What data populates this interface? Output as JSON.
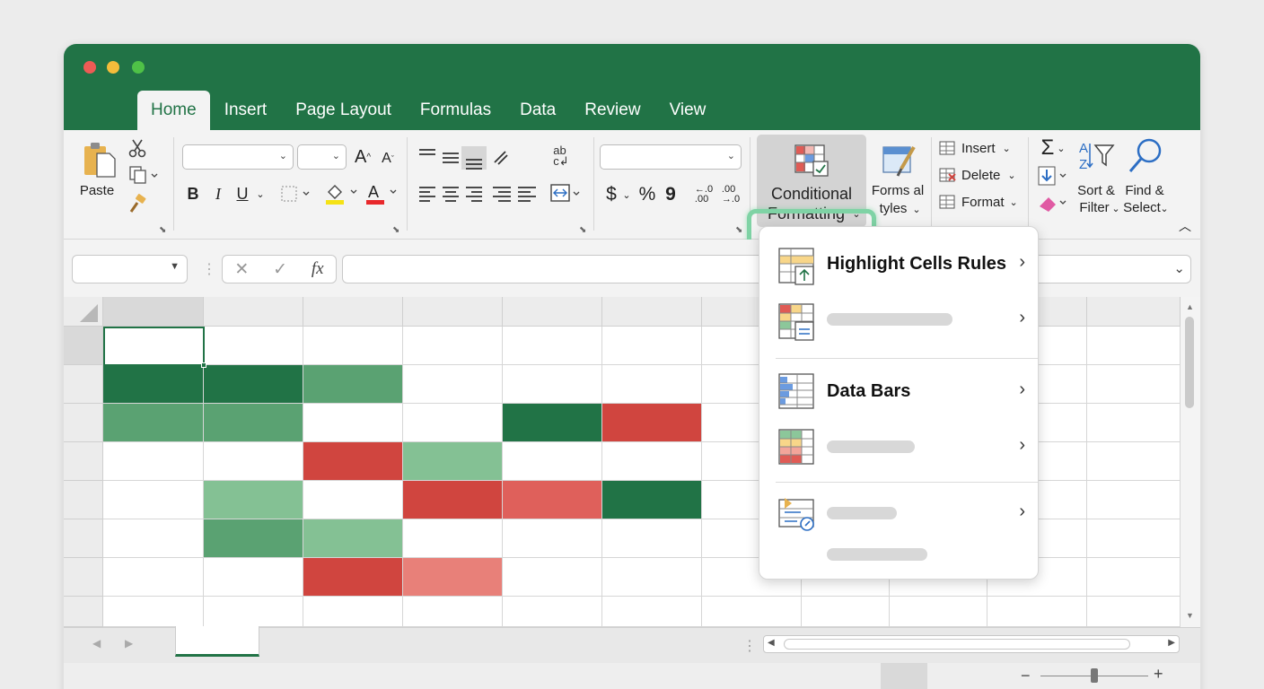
{
  "tabs": [
    "Home",
    "Insert",
    "Page Layout",
    "Formulas",
    "Data",
    "Review",
    "View"
  ],
  "active_tab": "Home",
  "clipboard": {
    "paste_label": "Paste"
  },
  "font_group": {
    "bold": "B",
    "italic": "I",
    "underline": "U"
  },
  "number_group": {
    "currency": "$",
    "percent": "%",
    "comma": "9",
    "inc_decimal": "←.0\n.00",
    "dec_decimal": ".00\n→.0"
  },
  "conditional_formatting": {
    "line1": "Conditional",
    "line2": "Formatting"
  },
  "format_as_table": {
    "line1": "Forms al",
    "line2": "tyles"
  },
  "cells_group": {
    "insert": "Insert",
    "delete": "Delete",
    "format": "Format"
  },
  "editing_group": {
    "sort_line1": "Sort &",
    "sort_line2": "Filter",
    "find_line1": "Find &",
    "find_line2": "Select"
  },
  "formula_bar": {
    "fx": "fx",
    "cancel": "✕",
    "enter": "✓"
  },
  "menu": {
    "items": [
      {
        "label": "Highlight Cells Rules"
      },
      {
        "label": ""
      },
      {
        "label": "Data Bars"
      },
      {
        "label": ""
      },
      {
        "label": ""
      }
    ]
  },
  "colors": {
    "brand_green": "#217346",
    "dark_green": "#217346",
    "mid_green": "#5aa272",
    "light_green": "#84c194",
    "red": "#d0453f",
    "light_red": "#df605b",
    "pink": "#e88079"
  },
  "grid_fills": [
    [
      "",
      "",
      "",
      "",
      "",
      "",
      ""
    ],
    [
      "dark_green",
      "dark_green",
      "mid_green",
      "",
      "",
      "",
      ""
    ],
    [
      "mid_green",
      "mid_green",
      "",
      "",
      "dark_green",
      "red",
      ""
    ],
    [
      "",
      "",
      "red",
      "light_green",
      "",
      "",
      ""
    ],
    [
      "",
      "light_green",
      "",
      "red",
      "light_red",
      "dark_green",
      ""
    ],
    [
      "",
      "mid_green",
      "light_green",
      "",
      "",
      "",
      ""
    ],
    [
      "",
      "",
      "red",
      "pink",
      "",
      "",
      ""
    ],
    [
      "",
      "",
      "",
      "",
      "",
      "",
      ""
    ]
  ],
  "icons": [
    "paste-icon",
    "cut-icon",
    "copy-icon",
    "format-painter-icon",
    "conditional-formatting-icon",
    "sum-icon",
    "sort-filter-icon",
    "find-icon"
  ]
}
